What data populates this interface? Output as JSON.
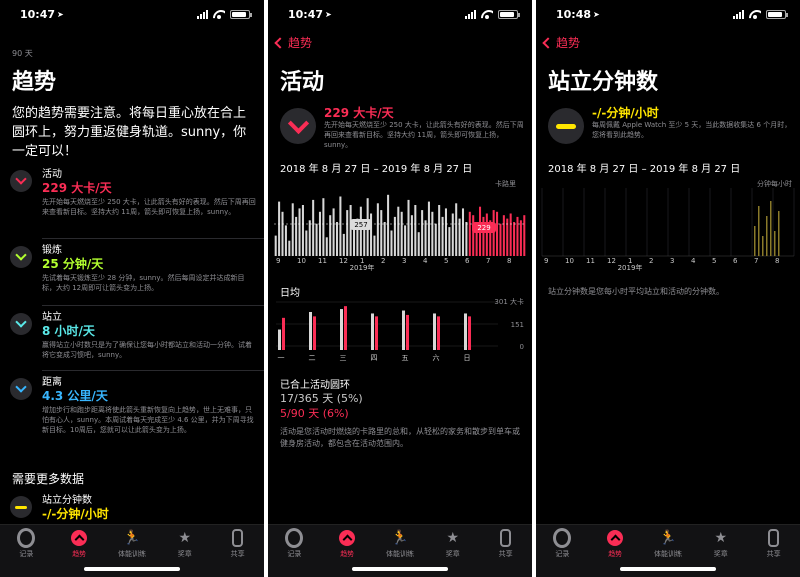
{
  "screen1": {
    "time": "10:47",
    "period": "90 天",
    "title": "趋势",
    "message": "您的趋势需要注意。将每日重心放在合上圆环上，努力重返健身轨道。sunny，你一定可以！",
    "items": [
      {
        "name": "活动",
        "value": "229 大卡/天",
        "color": "#fa2d55",
        "desc": "先开始每天燃烧至少 250 大卡，让此箭头有好的表现。然后下周再回来查看新目标。坚持大约 11周，箭头即可恢复上扬，sunny。"
      },
      {
        "name": "锻炼",
        "value": "25 分钟/天",
        "color": "#b2ff2f",
        "desc": "先试着每天锻炼至少 28 分钟，sunny。然后每周设定并达成新目标，大约 12周即可让箭头变为上扬。"
      },
      {
        "name": "站立",
        "value": "8 小时/天",
        "color": "#5ae8e8",
        "desc": "赢得站立小时数只是为了确保让您每小时都站立和活动一分钟。试着将它变成习惯吧，sunny。"
      },
      {
        "name": "距离",
        "value": "4.3 公里/天",
        "color": "#38b6ff",
        "desc": "增加步行和跑步距离将使此箭头重新恢复向上趋势，世上无难事，只怕有心人，sunny。本周试着每天完成至少 4.6 公里，并为下周寻找新目标。10周后，您就可以让此箭头变为上扬。"
      }
    ],
    "more_title": "需要更多数据",
    "more_item": {
      "name": "站立分钟数",
      "value": "-/-分钟/小时",
      "color": "#ffe600"
    }
  },
  "screen2": {
    "time": "10:47",
    "back": "趋势",
    "title": "活动",
    "value": "229 大卡/天",
    "desc": "先开始每天燃烧至少 250 大卡，让此箭头有好的表现。然后下周再回来查看新目标。坚持大约 11周，箭头即可恢复上扬，sunny。",
    "range": "2018 年 8 月 27 日 – 2019 年 8 月 27 日",
    "unit": "卡路里",
    "avg_gray": "257",
    "avg_red": "229",
    "year_label": "2019年",
    "months": [
      "9",
      "10",
      "11",
      "12",
      "1",
      "2",
      "3",
      "4",
      "5",
      "6",
      "7",
      "8"
    ],
    "daily_title": "日均",
    "daily_ticks": [
      "301 大卡",
      "151",
      "0"
    ],
    "weekdays": [
      "一",
      "二",
      "三",
      "四",
      "五",
      "六",
      "日"
    ],
    "closed_title": "已合上活动圆环",
    "closed_year": "17/365 天 (5%)",
    "closed_90": "5/90 天 (6%)",
    "foot": "活动是您活动时燃烧的卡路里的总和，从轻松的家务和散步到单车或健身房活动，都包含在活动范围内。"
  },
  "screen3": {
    "time": "10:48",
    "back": "趋势",
    "title": "站立分钟数",
    "value": "-/-分钟/小时",
    "desc": "每周佩戴 Apple Watch 至少 5 天，当此数据收集达 6 个月时，您将看到此趋势。",
    "range": "2018 年 8 月 27 日 – 2019 年 8 月 27 日",
    "unit": "分钟每小时",
    "year_label": "2019年",
    "months": [
      "9",
      "10",
      "11",
      "12",
      "1",
      "2",
      "3",
      "4",
      "5",
      "6",
      "7",
      "8"
    ],
    "foot": "站立分钟数是您每小时平均站立和活动的分钟数。"
  },
  "tabbar": {
    "tabs": [
      {
        "label": "记录",
        "icon": "rings-icon"
      },
      {
        "label": "趋势",
        "icon": "trend-icon"
      },
      {
        "label": "体能训练",
        "icon": "runner-icon"
      },
      {
        "label": "奖章",
        "icon": "award-star-icon"
      },
      {
        "label": "共享",
        "icon": "share-icon"
      }
    ],
    "active": 1
  },
  "colors": {
    "activity": "#fa2d55",
    "exercise": "#b2ff2f",
    "stand": "#5ae8e8",
    "distance": "#38b6ff",
    "standmin": "#ffe600",
    "background": "#000000"
  },
  "chart_data": [
    {
      "type": "bar",
      "title": "2018 年 8 月 27 日 – 2019 年 8 月 27 日",
      "ylabel": "卡路里",
      "x": [
        "9",
        "10",
        "11",
        "12",
        "1",
        "2",
        "3",
        "4",
        "5",
        "6",
        "7",
        "8"
      ],
      "series": [
        {
          "name": "",
          "values": [
            120,
            320,
            260,
            180,
            90,
            310,
            230,
            280,
            300,
            150,
            210,
            330,
            190,
            260,
            340,
            110,
            240,
            280,
            200,
            350,
            130,
            270,
            300,
            160,
            220,
            290,
            180,
            340,
            250,
            120,
            310,
            270,
            200,
            360,
            150,
            230,
            290,
            260,
            180,
            330,
            240,
            300,
            140,
            270,
            210,
            320,
            260,
            190,
            300,
            230,
            280,
            170,
            250,
            310,
            220,
            280,
            200,
            260,
            240,
            180,
            290,
            230,
            250,
            210,
            270,
            260,
            190,
            240,
            220,
            250,
            200,
            230,
            210,
            240
          ]
        }
      ],
      "averages": [
        {
          "label": "257",
          "value": 257
        },
        {
          "label": "229",
          "value": 229
        }
      ]
    },
    {
      "type": "bar",
      "title": "日均",
      "categories": [
        "一",
        "二",
        "三",
        "四",
        "五",
        "六",
        "日"
      ],
      "series": [
        {
          "name": "",
          "values": [
            140,
            260,
            280,
            250,
            270,
            250,
            250
          ]
        },
        {
          "name": "",
          "values": [
            220,
            230,
            300,
            230,
            240,
            230,
            230
          ]
        }
      ],
      "ylim": [
        0,
        301
      ]
    }
  ]
}
